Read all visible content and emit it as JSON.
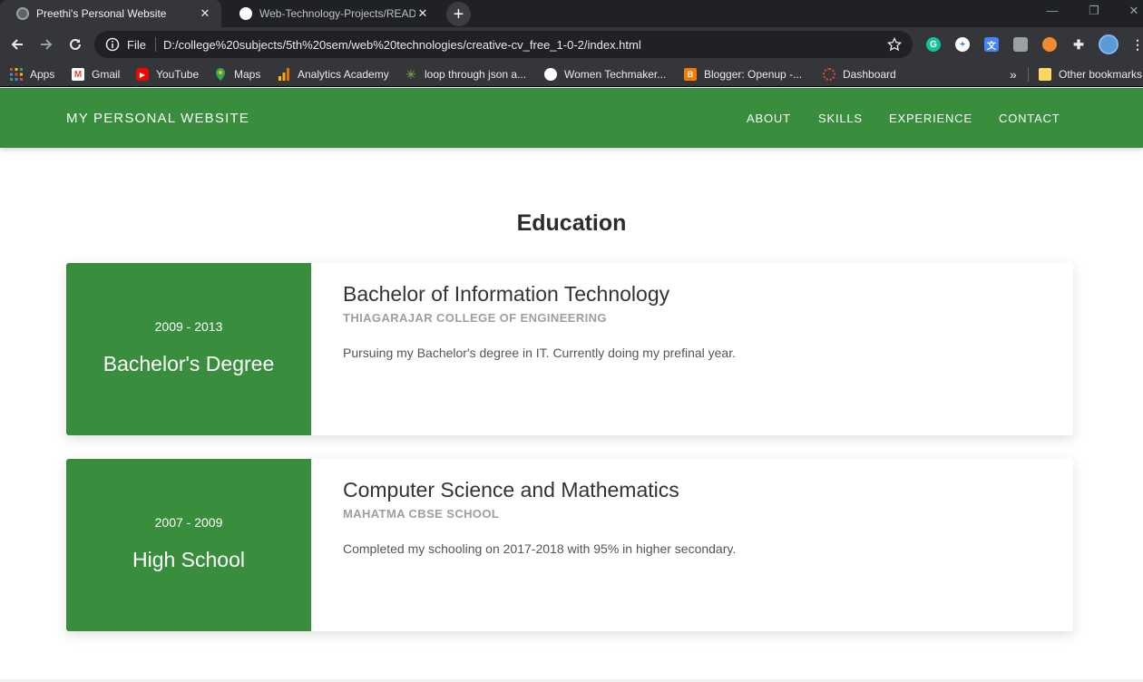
{
  "browser": {
    "tabs": [
      {
        "title": "Preethi's Personal Website",
        "active": true
      },
      {
        "title": "Web-Technology-Projects/READM",
        "active": false
      }
    ],
    "new_tab_symbol": "+",
    "window_controls": {
      "minimize": "—",
      "restore": "❐",
      "close": "✕"
    },
    "address": {
      "scheme": "File",
      "url": "D:/college%20subjects/5th%20sem/web%20technologies/creative-cv_free_1-0-2/index.html"
    },
    "extensions": [
      "grammarly-icon",
      "plus-extension-icon",
      "translate-icon",
      "camera-icon",
      "record-icon",
      "puzzle-icon",
      "profile-avatar-icon"
    ],
    "bookmarks": [
      {
        "label": "Apps",
        "icon": "apps-grid-icon"
      },
      {
        "label": "Gmail",
        "icon": "gmail-icon"
      },
      {
        "label": "YouTube",
        "icon": "youtube-icon"
      },
      {
        "label": "Maps",
        "icon": "maps-icon"
      },
      {
        "label": "Analytics Academy",
        "icon": "analytics-icon"
      },
      {
        "label": "loop through json a...",
        "icon": "asterisk-icon"
      },
      {
        "label": "Women Techmaker...",
        "icon": "globe-icon"
      },
      {
        "label": "Blogger: Openup -...",
        "icon": "blogger-icon"
      },
      {
        "label": "Dashboard",
        "icon": "dashboard-icon"
      }
    ],
    "bookmarks_overflow": "»",
    "other_bookmarks": "Other bookmarks"
  },
  "site": {
    "brand": "MY PERSONAL WEBSITE",
    "menu": [
      "ABOUT",
      "SKILLS",
      "EXPERIENCE",
      "CONTACT"
    ],
    "section_title": "Education",
    "education": [
      {
        "years": "2009 - 2013",
        "level": "Bachelor's Degree",
        "degree": "Bachelor of Information Technology",
        "institution": "THIAGARAJAR COLLEGE OF ENGINEERING",
        "description": "Pursuing my Bachelor's degree in IT. Currently doing my prefinal year."
      },
      {
        "years": "2007 - 2009",
        "level": "High School",
        "degree": "Computer Science and Mathematics",
        "institution": "MAHATMA CBSE SCHOOL",
        "description": "Completed my schooling on 2017-2018 with 95% in higher secondary."
      }
    ]
  },
  "colors": {
    "accent_green": "#388e3c",
    "chrome_dark": "#202124",
    "chrome_toolbar": "#35363a"
  }
}
